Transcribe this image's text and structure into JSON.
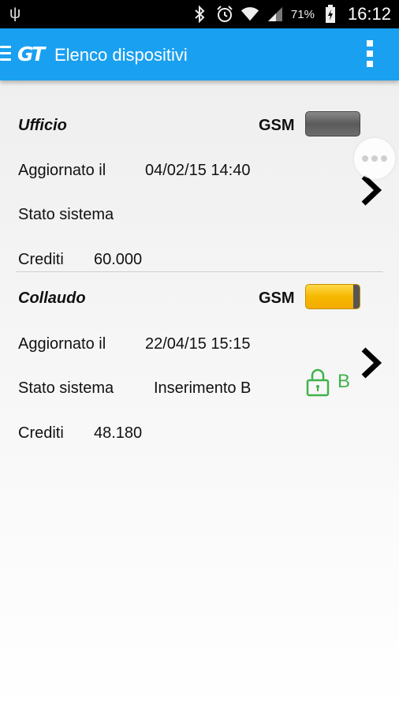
{
  "status_bar": {
    "battery_percent": "71%",
    "time": "16:12",
    "icons": [
      "usb-icon",
      "bluetooth-icon",
      "alarm-icon",
      "wifi-icon",
      "cell-signal-icon",
      "battery-icon"
    ]
  },
  "app_bar": {
    "logo": "GT",
    "title": "Elenco dispositivi",
    "menu_icon": "hamburger-icon",
    "overflow_icon": "overflow-menu-icon"
  },
  "devices": [
    {
      "name": "Ufficio",
      "gsm_label": "GSM",
      "gsm_signal_color": "#6e6e6e",
      "updated_label": "Aggiornato il",
      "updated_value": "04/02/15 14:40",
      "status_label": "Stato sistema",
      "status_value": "",
      "credits_label": "Crediti",
      "credits_value": "60.000"
    },
    {
      "name": "Collaudo",
      "gsm_label": "GSM",
      "gsm_signal_color": "#f6b800",
      "updated_label": "Aggiornato il",
      "updated_value": "22/04/15 15:15",
      "status_label": "Stato sistema",
      "status_value": "Inserimento B",
      "status_icon": "lock-icon",
      "status_letter": "B",
      "status_color": "#3fb34a",
      "credits_label": "Crediti",
      "credits_value": "48.180"
    }
  ]
}
